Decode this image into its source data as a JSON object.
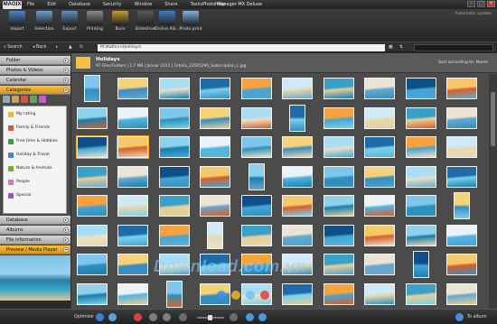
{
  "titlebar": {
    "logo": "MAGIX",
    "title": "Photo Manager MX Deluxe",
    "menu": [
      "File",
      "Edit",
      "Database",
      "Security",
      "Window",
      "Share",
      "Tasks",
      "Help"
    ]
  },
  "toolbar": {
    "tools": [
      {
        "label": "Import",
        "color": "#4a86c5"
      },
      {
        "label": "Selection",
        "color": "#6e9fd0"
      },
      {
        "label": "Export",
        "color": "#5e8fc2"
      },
      {
        "label": "Printing",
        "color": "#8a8a8a"
      },
      {
        "label": "Burn",
        "color": "#c99a2d"
      },
      {
        "label": "Slideshow",
        "color": "#5a5a5a"
      },
      {
        "label": "Online Alb...",
        "color": "#3e7fc8"
      },
      {
        "label": "Photo print",
        "color": "#7fb3e3"
      }
    ],
    "update_text": "Automatic update"
  },
  "navbar": {
    "search_label": "Search",
    "back_label": "Back",
    "path": "M:\\Kathrin\\Holidays\\"
  },
  "sidebar": {
    "panels_top": [
      "Folder",
      "Photos & Videos",
      "Calendar",
      "Categories"
    ],
    "categories": [
      {
        "label": "My rating",
        "color": "#f0b82a"
      },
      {
        "label": "Family & Friends",
        "color": "#e0543a"
      },
      {
        "label": "Free time & Hobbies",
        "color": "#3e9a4a"
      },
      {
        "label": "Holiday & Travel",
        "color": "#3a8ad6"
      },
      {
        "label": "Nature & Animals",
        "color": "#69b33a"
      },
      {
        "label": "People",
        "color": "#d478b5"
      },
      {
        "label": "Special",
        "color": "#8e5ac8"
      }
    ],
    "panels_bottom": [
      "Database",
      "Albums",
      "File information",
      "Preview / Media Player"
    ]
  },
  "content": {
    "title": "Holidays",
    "subtitle": "97 Files/Folders | 1.7 MB | Januar 2011 | Fotolia_23505296_Subscription_L.jpg",
    "sort_label": "Sort according to: Name"
  },
  "watermark": "Download.com.vn",
  "bottombar": {
    "left_label": "Optimize",
    "right_label": "To album"
  },
  "thumb_palettes": [
    [
      "#7ec6ec",
      "#2f8fbf"
    ],
    [
      "#f3d27a",
      "#3a8cc1"
    ],
    [
      "#a9dcf5",
      "#e9e1c5"
    ],
    [
      "#1f6aa8",
      "#7ad0ea"
    ],
    [
      "#f7a23c",
      "#4aa3d0"
    ],
    [
      "#cfe9f7",
      "#e6d9b0"
    ],
    [
      "#3aa0c7",
      "#e3cf98"
    ],
    [
      "#eae4d4",
      "#6aa7cf"
    ],
    [
      "#0f4f85",
      "#43a6d9"
    ],
    [
      "#f5c86a",
      "#d8602a"
    ],
    [
      "#8fd0ea",
      "#187fb0"
    ],
    [
      "#e9f3f8",
      "#55b4dc"
    ]
  ]
}
